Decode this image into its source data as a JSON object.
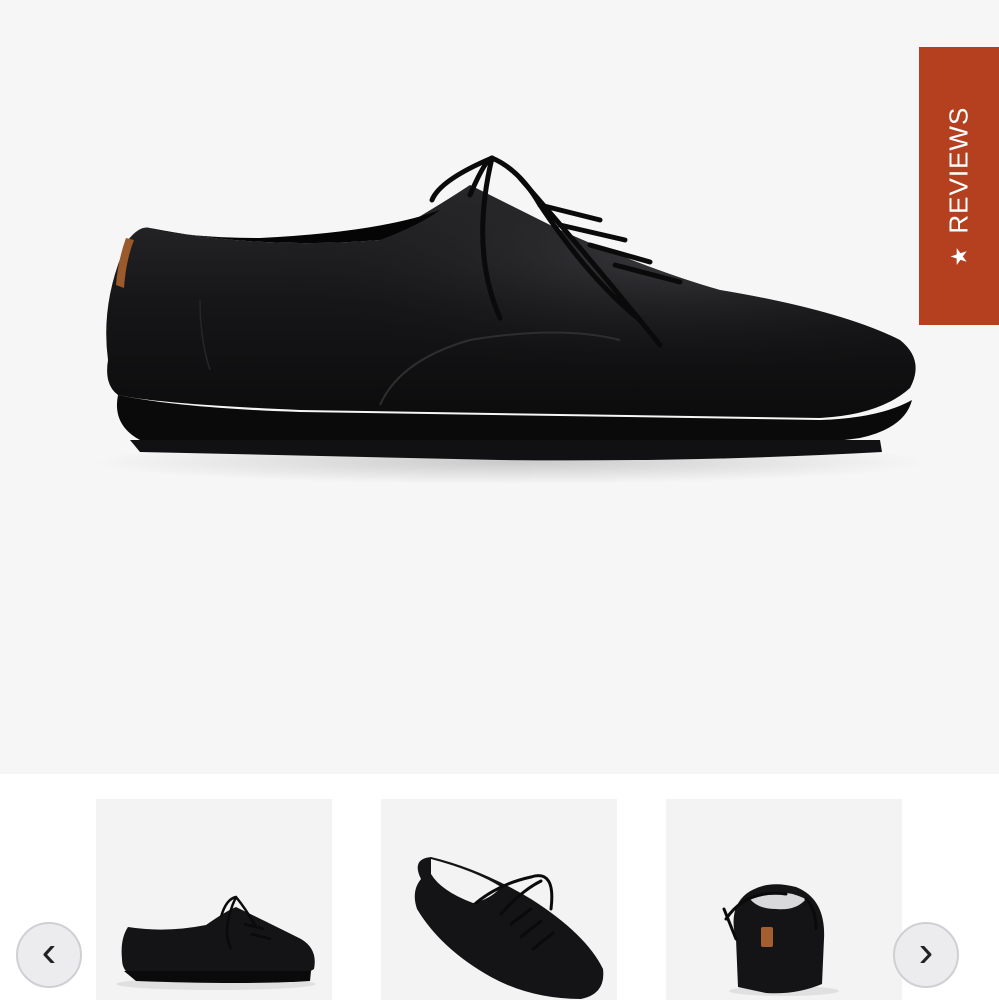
{
  "reviews_tab": {
    "label": "REVIEWS",
    "star": "★",
    "color": "#b5401f"
  },
  "gallery": {
    "main_image": "black-leather-lace-up-shoe-side-view",
    "thumbnails": [
      "black-leather-shoe-side-view",
      "black-leather-shoe-top-angle-view",
      "black-leather-shoe-rear-view"
    ],
    "prev_icon": "chevron-left-icon",
    "next_icon": "chevron-right-icon",
    "prev_glyph": "‹",
    "next_glyph": "›"
  }
}
